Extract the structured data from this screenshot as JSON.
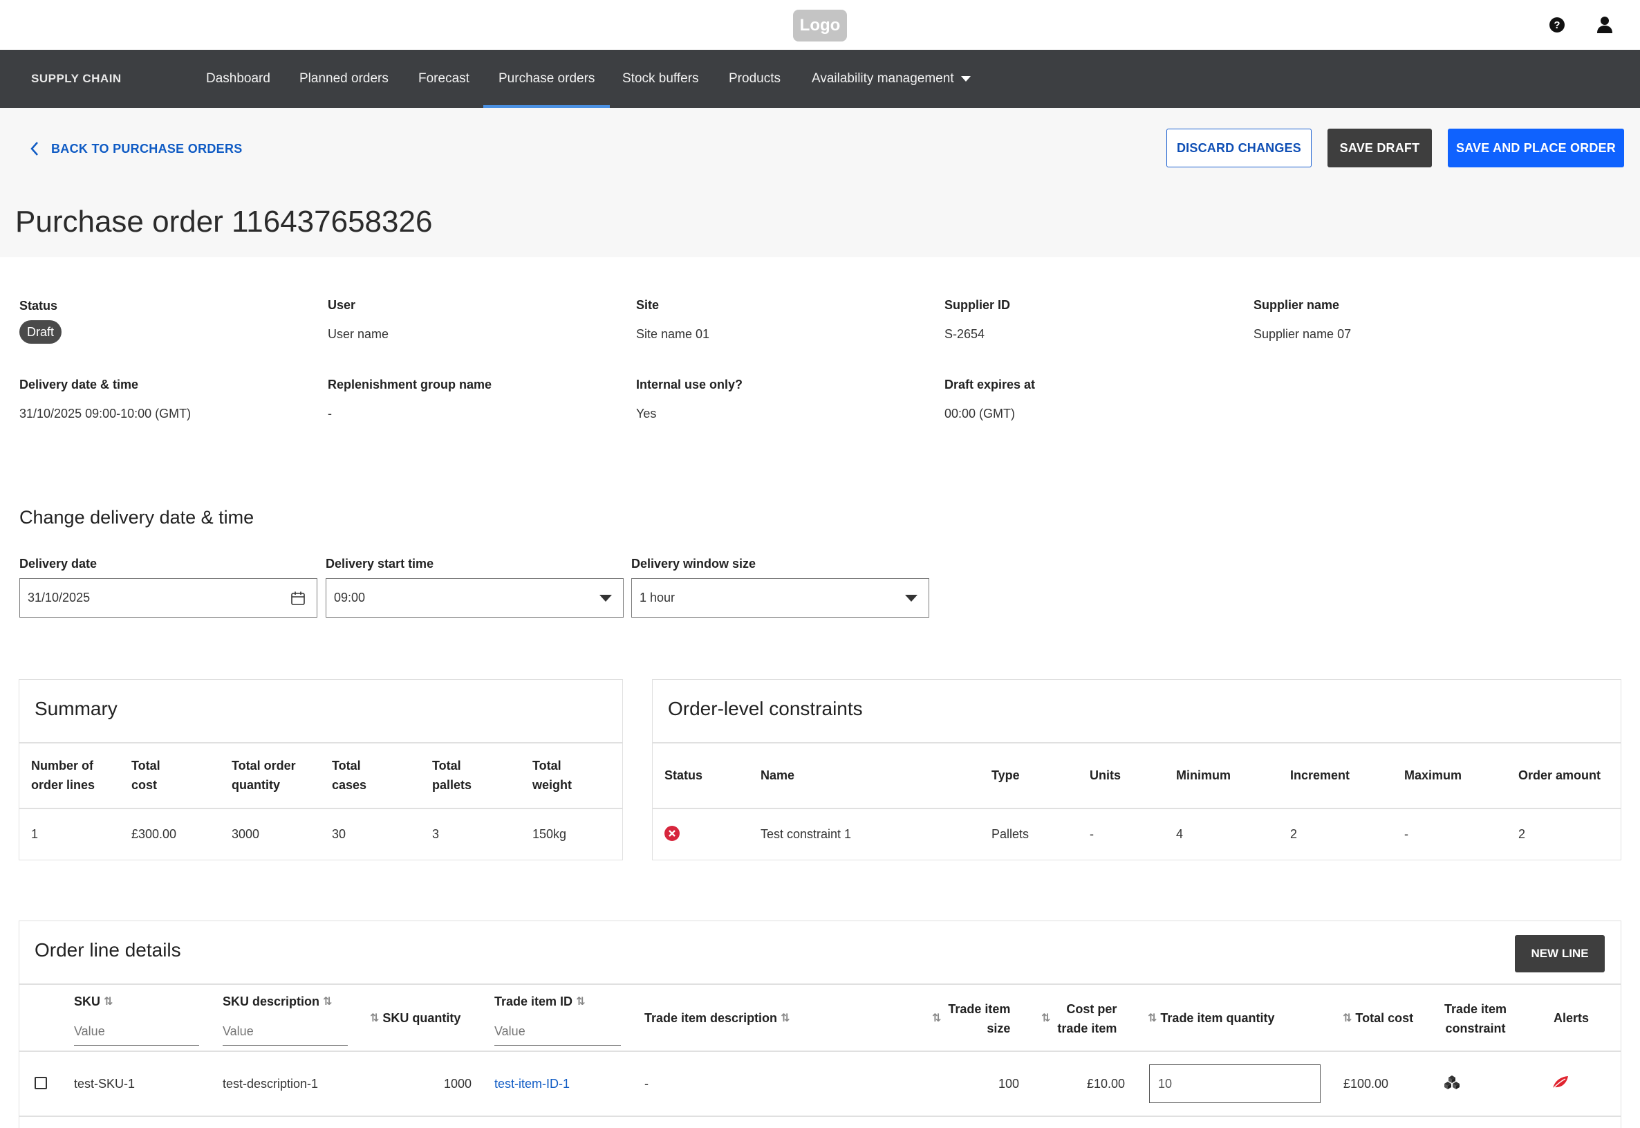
{
  "header": {
    "logo": "Logo"
  },
  "nav": {
    "brand": "SUPPLY CHAIN",
    "items": [
      {
        "label": "Dashboard"
      },
      {
        "label": "Planned orders"
      },
      {
        "label": "Forecast"
      },
      {
        "label": "Purchase orders"
      },
      {
        "label": "Stock buffers"
      },
      {
        "label": "Products"
      },
      {
        "label": "Availability management"
      }
    ],
    "active": "Purchase orders"
  },
  "actions": {
    "back": "BACK TO PURCHASE ORDERS",
    "discard": "DISCARD CHANGES",
    "save_draft": "SAVE DRAFT",
    "save_place": "SAVE AND PLACE ORDER"
  },
  "page_title": "Purchase order 116437658326",
  "info": {
    "status_label": "Status",
    "status_value": "Draft",
    "user_label": "User",
    "user_value": "User name",
    "site_label": "Site",
    "site_value": "Site name 01",
    "supplier_id_label": "Supplier ID",
    "supplier_id_value": "S-2654",
    "supplier_name_label": "Supplier name",
    "supplier_name_value": "Supplier name 07",
    "delivery_label": "Delivery date & time",
    "delivery_value": "31/10/2025 09:00-10:00 (GMT)",
    "replen_label": "Replenishment group name",
    "replen_value": "-",
    "internal_label": "Internal use only?",
    "internal_value": "Yes",
    "expires_label": "Draft expires at",
    "expires_value": "00:00 (GMT)"
  },
  "change_delivery": {
    "title": "Change delivery date & time",
    "date_label": "Delivery date",
    "date_value": "31/10/2025",
    "start_label": "Delivery start time",
    "start_value": "09:00",
    "window_label": "Delivery window size",
    "window_value": "1 hour"
  },
  "summary": {
    "title": "Summary",
    "headers": [
      "Number of order lines",
      "Total cost",
      "Total order quantity",
      "Total cases",
      "Total pallets",
      "Total weight"
    ],
    "header_lines": [
      [
        "Number of",
        "order lines"
      ],
      [
        "Total",
        "cost"
      ],
      [
        "Total order",
        "quantity"
      ],
      [
        "Total",
        "cases"
      ],
      [
        "Total",
        "pallets"
      ],
      [
        "Total",
        "weight"
      ]
    ],
    "values": [
      "1",
      "£300.00",
      "3000",
      "30",
      "3",
      "150kg"
    ]
  },
  "constraints": {
    "title": "Order-level constraints",
    "headers": [
      "Status",
      "Name",
      "Type",
      "Units",
      "Minimum",
      "Increment",
      "Maximum",
      "Order amount"
    ],
    "rows": [
      {
        "status": "error",
        "name": "Test constraint 1",
        "type": "Pallets",
        "units": "-",
        "minimum": "4",
        "increment": "2",
        "maximum": "-",
        "order_amount": "2"
      }
    ],
    "status_color": "#d7263d"
  },
  "order_lines": {
    "title": "Order line details",
    "new_line": "NEW LINE",
    "headers": {
      "sku": "SKU",
      "sku_desc": "SKU description",
      "sku_qty": "SKU quantity",
      "trade_item_id": "Trade item ID",
      "trade_item_desc": "Trade item description",
      "trade_item_size_1": "Trade item",
      "trade_item_size_2": "size",
      "cost_per_1": "Cost per",
      "cost_per_2": "trade item",
      "trade_item_qty": "Trade item quantity",
      "total_cost": "Total cost",
      "constraint_1": "Trade item",
      "constraint_2": "constraint",
      "alerts": "Alerts"
    },
    "filter_placeholder": "Value",
    "rows": [
      {
        "sku": "test-SKU-1",
        "sku_desc": "test-description-1",
        "sku_qty": "1000",
        "trade_item_id": "test-item-ID-1",
        "trade_item_desc": "-",
        "trade_item_size": "100",
        "cost_per": "£10.00",
        "trade_item_qty": "10",
        "total_cost": "£100.00",
        "constraint_icon": "boxes-icon",
        "alert_icon": "leaf-icon"
      }
    ]
  },
  "colors": {
    "nav_bg": "#3d3f42",
    "primary": "#0f62fe",
    "link": "#0f5bc4",
    "alert": "#e0242f"
  }
}
